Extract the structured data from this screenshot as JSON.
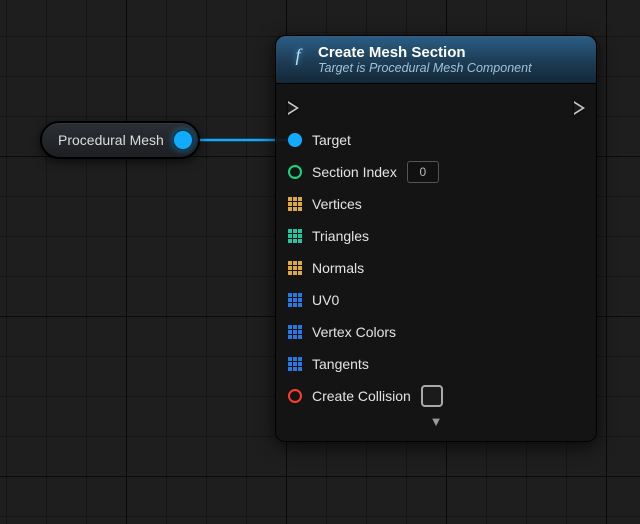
{
  "var_node": {
    "label": "Procedural Mesh"
  },
  "fn_node": {
    "title": "Create Mesh Section",
    "subtitle": "Target is Procedural Mesh Component",
    "pins": {
      "target": "Target",
      "section_index": {
        "label": "Section Index",
        "value": "0"
      },
      "vertices": "Vertices",
      "triangles": "Triangles",
      "normals": "Normals",
      "uv0": "UV0",
      "vertex_colors": "Vertex Colors",
      "tangents": "Tangents",
      "create_collision": "Create Collision"
    },
    "expand_glyph": "▼"
  }
}
